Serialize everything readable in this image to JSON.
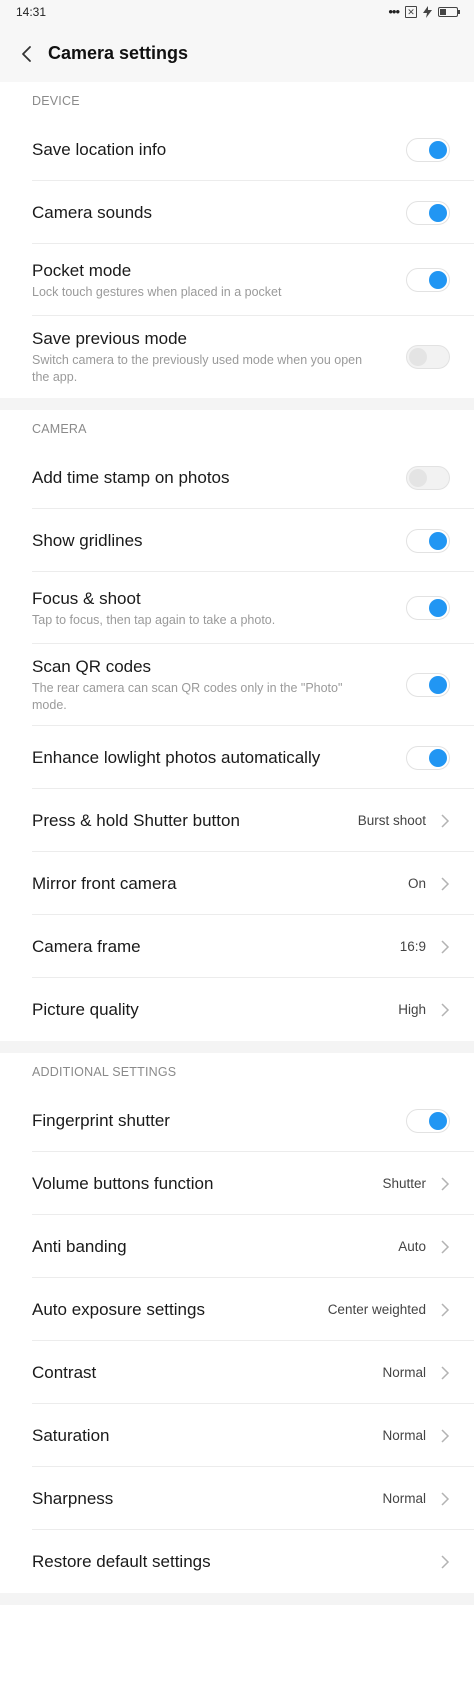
{
  "status_bar": {
    "time": "14:31",
    "sim_symbol": "✕"
  },
  "header": {
    "title": "Camera settings"
  },
  "sections": {
    "device": {
      "label": "DEVICE",
      "save_location": {
        "title": "Save location info",
        "state": "on"
      },
      "camera_sounds": {
        "title": "Camera sounds",
        "state": "on"
      },
      "pocket_mode": {
        "title": "Pocket mode",
        "subtitle": "Lock touch gestures when placed in a pocket",
        "state": "on"
      },
      "save_previous": {
        "title": "Save previous mode",
        "subtitle": "Switch camera to the previously used mode when you open the app.",
        "state": "off"
      }
    },
    "camera": {
      "label": "CAMERA",
      "time_stamp": {
        "title": "Add time stamp on photos",
        "state": "off"
      },
      "gridlines": {
        "title": "Show gridlines",
        "state": "on"
      },
      "focus_shoot": {
        "title": "Focus & shoot",
        "subtitle": "Tap to focus, then tap again to take a photo.",
        "state": "on"
      },
      "scan_qr": {
        "title": "Scan QR codes",
        "subtitle": "The rear camera can scan QR codes only in the \"Photo\" mode.",
        "state": "on"
      },
      "lowlight": {
        "title": "Enhance lowlight photos automatically",
        "state": "on"
      },
      "press_hold": {
        "title": "Press & hold Shutter button",
        "value": "Burst shoot"
      },
      "mirror_front": {
        "title": "Mirror front camera",
        "value": "On"
      },
      "camera_frame": {
        "title": "Camera frame",
        "value": "16:9"
      },
      "picture_quality": {
        "title": "Picture quality",
        "value": "High"
      }
    },
    "additional": {
      "label": "ADDITIONAL SETTINGS",
      "fingerprint": {
        "title": "Fingerprint shutter",
        "state": "on"
      },
      "volume_buttons": {
        "title": "Volume buttons function",
        "value": "Shutter"
      },
      "anti_banding": {
        "title": "Anti banding",
        "value": "Auto"
      },
      "auto_exposure": {
        "title": "Auto exposure settings",
        "value": "Center weighted"
      },
      "contrast": {
        "title": "Contrast",
        "value": "Normal"
      },
      "saturation": {
        "title": "Saturation",
        "value": "Normal"
      },
      "sharpness": {
        "title": "Sharpness",
        "value": "Normal"
      },
      "restore": {
        "title": "Restore default settings"
      }
    }
  },
  "colors": {
    "accent": "#2196f3",
    "section_label": "#8a8a8a",
    "subtitle": "#9a9a9a",
    "divider": "#ececec",
    "gap": "#f4f4f4"
  },
  "icons": {
    "back": "chevron-left-icon",
    "row_arrow": "chevron-right-icon"
  }
}
